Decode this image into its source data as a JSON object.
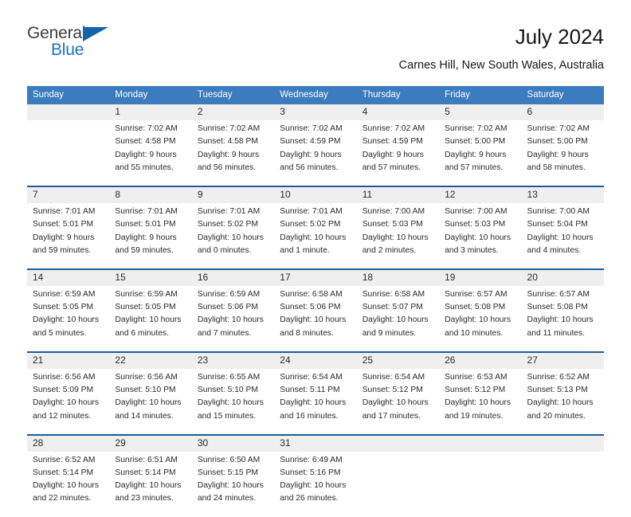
{
  "brand": {
    "name_part1": "General",
    "name_part2": "Blue",
    "accent_color": "#1a74bd",
    "triangle_color": "#1464aa"
  },
  "header": {
    "title": "July 2024",
    "subtitle": "Carnes Hill, New South Wales, Australia"
  },
  "theme": {
    "header_bar_color": "#3a7cbe",
    "week_separator_color": "#1c5c9e",
    "daynum_band_color": "#efefef"
  },
  "calendar": {
    "weekday_headers": [
      "Sunday",
      "Monday",
      "Tuesday",
      "Wednesday",
      "Thursday",
      "Friday",
      "Saturday"
    ],
    "weeks": [
      {
        "days": [
          {
            "num": "",
            "lines": []
          },
          {
            "num": "1",
            "lines": [
              "Sunrise: 7:02 AM",
              "Sunset: 4:58 PM",
              "Daylight: 9 hours",
              "and 55 minutes."
            ]
          },
          {
            "num": "2",
            "lines": [
              "Sunrise: 7:02 AM",
              "Sunset: 4:58 PM",
              "Daylight: 9 hours",
              "and 56 minutes."
            ]
          },
          {
            "num": "3",
            "lines": [
              "Sunrise: 7:02 AM",
              "Sunset: 4:59 PM",
              "Daylight: 9 hours",
              "and 56 minutes."
            ]
          },
          {
            "num": "4",
            "lines": [
              "Sunrise: 7:02 AM",
              "Sunset: 4:59 PM",
              "Daylight: 9 hours",
              "and 57 minutes."
            ]
          },
          {
            "num": "5",
            "lines": [
              "Sunrise: 7:02 AM",
              "Sunset: 5:00 PM",
              "Daylight: 9 hours",
              "and 57 minutes."
            ]
          },
          {
            "num": "6",
            "lines": [
              "Sunrise: 7:02 AM",
              "Sunset: 5:00 PM",
              "Daylight: 9 hours",
              "and 58 minutes."
            ]
          }
        ]
      },
      {
        "days": [
          {
            "num": "7",
            "lines": [
              "Sunrise: 7:01 AM",
              "Sunset: 5:01 PM",
              "Daylight: 9 hours",
              "and 59 minutes."
            ]
          },
          {
            "num": "8",
            "lines": [
              "Sunrise: 7:01 AM",
              "Sunset: 5:01 PM",
              "Daylight: 9 hours",
              "and 59 minutes."
            ]
          },
          {
            "num": "9",
            "lines": [
              "Sunrise: 7:01 AM",
              "Sunset: 5:02 PM",
              "Daylight: 10 hours",
              "and 0 minutes."
            ]
          },
          {
            "num": "10",
            "lines": [
              "Sunrise: 7:01 AM",
              "Sunset: 5:02 PM",
              "Daylight: 10 hours",
              "and 1 minute."
            ]
          },
          {
            "num": "11",
            "lines": [
              "Sunrise: 7:00 AM",
              "Sunset: 5:03 PM",
              "Daylight: 10 hours",
              "and 2 minutes."
            ]
          },
          {
            "num": "12",
            "lines": [
              "Sunrise: 7:00 AM",
              "Sunset: 5:03 PM",
              "Daylight: 10 hours",
              "and 3 minutes."
            ]
          },
          {
            "num": "13",
            "lines": [
              "Sunrise: 7:00 AM",
              "Sunset: 5:04 PM",
              "Daylight: 10 hours",
              "and 4 minutes."
            ]
          }
        ]
      },
      {
        "days": [
          {
            "num": "14",
            "lines": [
              "Sunrise: 6:59 AM",
              "Sunset: 5:05 PM",
              "Daylight: 10 hours",
              "and 5 minutes."
            ]
          },
          {
            "num": "15",
            "lines": [
              "Sunrise: 6:59 AM",
              "Sunset: 5:05 PM",
              "Daylight: 10 hours",
              "and 6 minutes."
            ]
          },
          {
            "num": "16",
            "lines": [
              "Sunrise: 6:59 AM",
              "Sunset: 5:06 PM",
              "Daylight: 10 hours",
              "and 7 minutes."
            ]
          },
          {
            "num": "17",
            "lines": [
              "Sunrise: 6:58 AM",
              "Sunset: 5:06 PM",
              "Daylight: 10 hours",
              "and 8 minutes."
            ]
          },
          {
            "num": "18",
            "lines": [
              "Sunrise: 6:58 AM",
              "Sunset: 5:07 PM",
              "Daylight: 10 hours",
              "and 9 minutes."
            ]
          },
          {
            "num": "19",
            "lines": [
              "Sunrise: 6:57 AM",
              "Sunset: 5:08 PM",
              "Daylight: 10 hours",
              "and 10 minutes."
            ]
          },
          {
            "num": "20",
            "lines": [
              "Sunrise: 6:57 AM",
              "Sunset: 5:08 PM",
              "Daylight: 10 hours",
              "and 11 minutes."
            ]
          }
        ]
      },
      {
        "days": [
          {
            "num": "21",
            "lines": [
              "Sunrise: 6:56 AM",
              "Sunset: 5:09 PM",
              "Daylight: 10 hours",
              "and 12 minutes."
            ]
          },
          {
            "num": "22",
            "lines": [
              "Sunrise: 6:56 AM",
              "Sunset: 5:10 PM",
              "Daylight: 10 hours",
              "and 14 minutes."
            ]
          },
          {
            "num": "23",
            "lines": [
              "Sunrise: 6:55 AM",
              "Sunset: 5:10 PM",
              "Daylight: 10 hours",
              "and 15 minutes."
            ]
          },
          {
            "num": "24",
            "lines": [
              "Sunrise: 6:54 AM",
              "Sunset: 5:11 PM",
              "Daylight: 10 hours",
              "and 16 minutes."
            ]
          },
          {
            "num": "25",
            "lines": [
              "Sunrise: 6:54 AM",
              "Sunset: 5:12 PM",
              "Daylight: 10 hours",
              "and 17 minutes."
            ]
          },
          {
            "num": "26",
            "lines": [
              "Sunrise: 6:53 AM",
              "Sunset: 5:12 PM",
              "Daylight: 10 hours",
              "and 19 minutes."
            ]
          },
          {
            "num": "27",
            "lines": [
              "Sunrise: 6:52 AM",
              "Sunset: 5:13 PM",
              "Daylight: 10 hours",
              "and 20 minutes."
            ]
          }
        ]
      },
      {
        "days": [
          {
            "num": "28",
            "lines": [
              "Sunrise: 6:52 AM",
              "Sunset: 5:14 PM",
              "Daylight: 10 hours",
              "and 22 minutes."
            ]
          },
          {
            "num": "29",
            "lines": [
              "Sunrise: 6:51 AM",
              "Sunset: 5:14 PM",
              "Daylight: 10 hours",
              "and 23 minutes."
            ]
          },
          {
            "num": "30",
            "lines": [
              "Sunrise: 6:50 AM",
              "Sunset: 5:15 PM",
              "Daylight: 10 hours",
              "and 24 minutes."
            ]
          },
          {
            "num": "31",
            "lines": [
              "Sunrise: 6:49 AM",
              "Sunset: 5:16 PM",
              "Daylight: 10 hours",
              "and 26 minutes."
            ]
          },
          {
            "num": "",
            "lines": []
          },
          {
            "num": "",
            "lines": []
          },
          {
            "num": "",
            "lines": []
          }
        ]
      }
    ]
  }
}
